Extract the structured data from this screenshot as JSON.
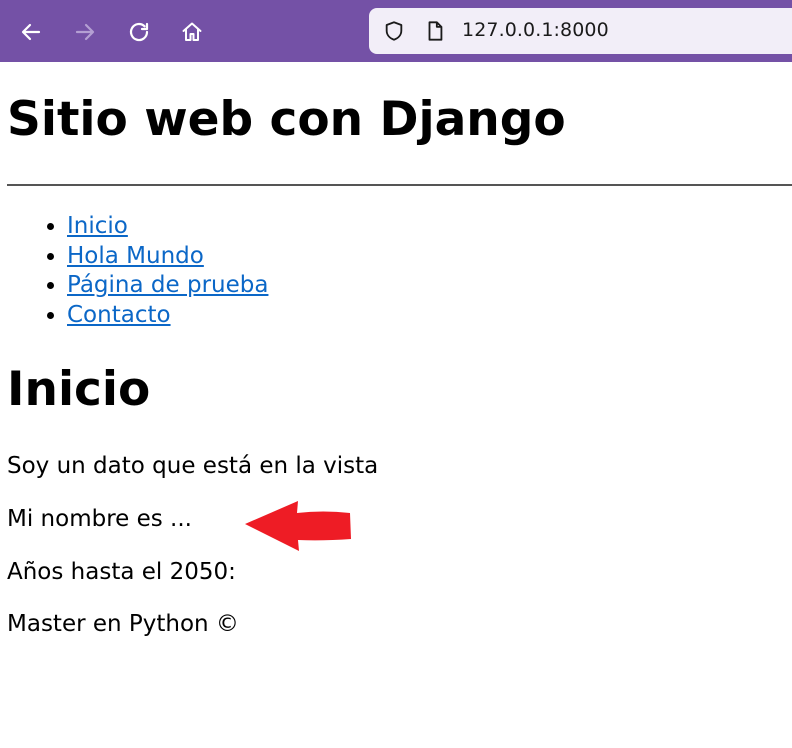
{
  "browser": {
    "url": "127.0.0.1:8000",
    "toolbar_color": "#7451a6"
  },
  "page": {
    "site_title": "Sitio web con Django",
    "nav": [
      {
        "label": "Inicio"
      },
      {
        "label": "Hola Mundo"
      },
      {
        "label": "Página de prueba"
      },
      {
        "label": "Contacto"
      }
    ],
    "section_title": "Inicio",
    "lines": [
      "Soy un dato que está en la vista",
      "Mi nombre es ...",
      "Años hasta el 2050:",
      "Master en Python ©"
    ]
  },
  "annotation": {
    "arrow_color": "#ee1c25"
  }
}
